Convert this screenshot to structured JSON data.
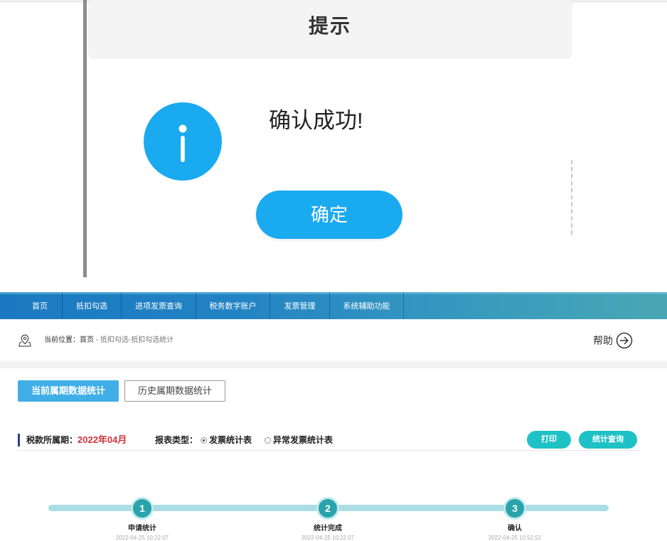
{
  "dialog": {
    "title": "提示",
    "message": "确认成功!",
    "confirm_label": "确定",
    "icon": "info-icon"
  },
  "nav": {
    "items": [
      {
        "label": "首页"
      },
      {
        "label": "抵扣勾选"
      },
      {
        "label": "进项发票查询"
      },
      {
        "label": "税务数字账户"
      },
      {
        "label": "发票管理"
      },
      {
        "label": "系统辅助功能"
      }
    ]
  },
  "breadcrumb": {
    "icon": "map-pin-icon",
    "prefix": "当前位置：首页",
    "path": " - 抵扣勾选-抵扣勾选统计",
    "help_label": "帮助",
    "help_icon": "arrow-circle-right-icon"
  },
  "tabs": [
    {
      "label": "当前属期数据统计",
      "active": true
    },
    {
      "label": "历史属期数据统计",
      "active": false
    }
  ],
  "filters": {
    "period_label": "税款所属期：",
    "period_value": "2022年04月",
    "report_type_label": "报表类型：",
    "report_types": [
      {
        "label": "发票统计表",
        "selected": true
      },
      {
        "label": "异常发票统计表",
        "selected": false
      }
    ]
  },
  "actions": {
    "print_label": "打印",
    "query_label": "统计查询"
  },
  "steps": [
    {
      "number": "1",
      "label": "申请统计",
      "time": "2022-04-25 10:22:07"
    },
    {
      "number": "2",
      "label": "统计完成",
      "time": "2022-04-25 10:22:07"
    },
    {
      "number": "3",
      "label": "确认",
      "time": "2022-04-25 10:52:52"
    }
  ],
  "colors": {
    "dialog_accent": "#1aaaf0",
    "nav_start": "#1a79c0",
    "nav_end": "#49a7b4",
    "tab_active": "#40aee7",
    "period_value": "#d0343a",
    "action_button": "#1ec1c6",
    "step_circle": "#2aa3aa",
    "step_track": "#aadee4"
  }
}
